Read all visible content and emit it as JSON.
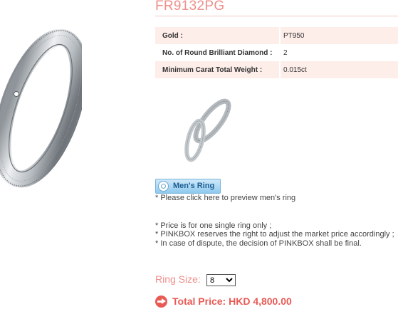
{
  "product": {
    "code": "FR9132PG"
  },
  "specs": [
    {
      "label": "Gold :",
      "value": "PT950"
    },
    {
      "label": "No. of Round Brilliant Diamond :",
      "value": "2"
    },
    {
      "label": "Minimum Carat Total Weight :",
      "value": "0.015ct"
    }
  ],
  "mens_ring": {
    "button_label": "Men's Ring",
    "note": "* Please click here to preview men's ring"
  },
  "notes": [
    "* Price is for one single ring only ;",
    "* PINKBOX reserves the right to adjust the market price accordingly ;",
    "* In case of dispute, the decision of PINKBOX shall be final."
  ],
  "ring_size": {
    "label": "Ring Size:",
    "selected": "8"
  },
  "total": {
    "text": "Total Price: HKD 4,800.00"
  },
  "icons": [
    "ring-icon",
    "arrow-right-circle-icon"
  ],
  "colors": {
    "accent": "#ef8f8b",
    "price": "#e95a55",
    "row_shade": "#fdeee9"
  }
}
